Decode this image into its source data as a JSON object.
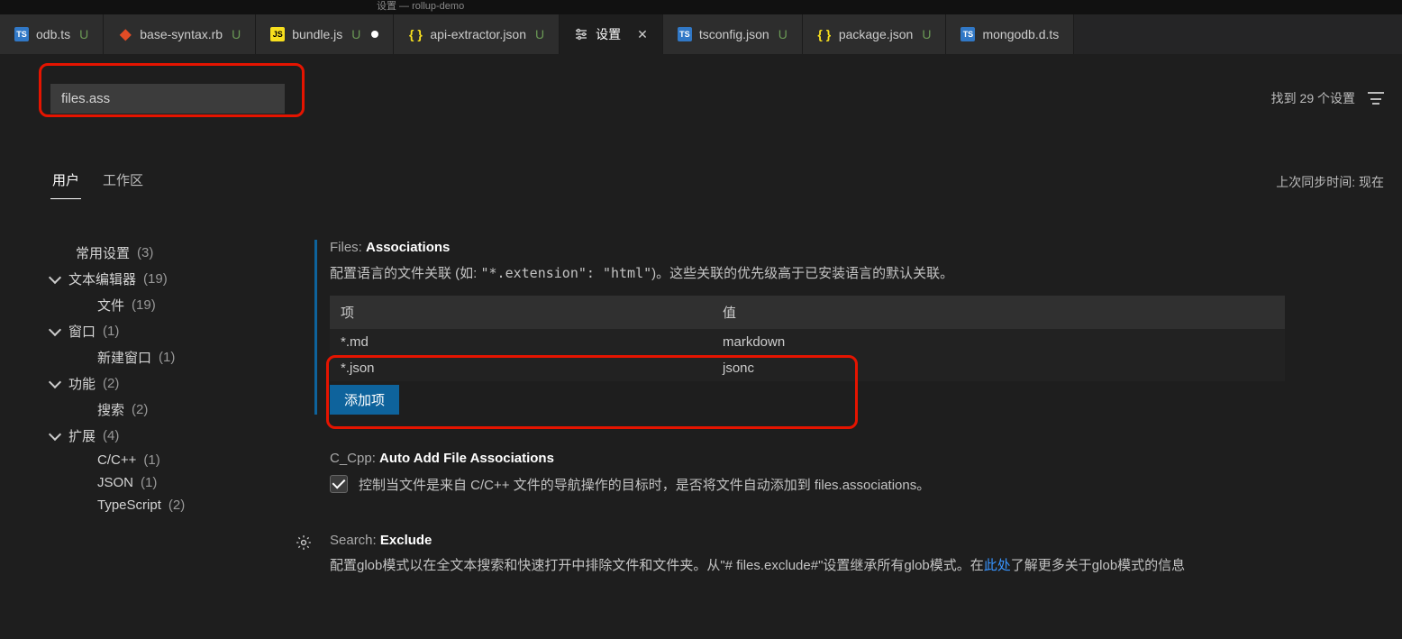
{
  "window": {
    "title": "设置 — rollup-demo"
  },
  "tabs": [
    {
      "label": "odb.ts",
      "icon": "ts",
      "git": "U",
      "active": false,
      "dirty": false,
      "close": false
    },
    {
      "label": "base-syntax.rb",
      "icon": "rb",
      "git": "U",
      "active": false,
      "dirty": false,
      "close": false
    },
    {
      "label": "bundle.js",
      "icon": "js",
      "git": "U",
      "active": false,
      "dirty": true,
      "close": false
    },
    {
      "label": "api-extractor.json",
      "icon": "json",
      "git": "U",
      "active": false,
      "dirty": false,
      "close": false
    },
    {
      "label": "设置",
      "icon": "settings",
      "git": "",
      "active": true,
      "dirty": false,
      "close": true
    },
    {
      "label": "tsconfig.json",
      "icon": "ts",
      "git": "U",
      "active": false,
      "dirty": false,
      "close": false
    },
    {
      "label": "package.json",
      "icon": "json",
      "git": "U",
      "active": false,
      "dirty": false,
      "close": false
    },
    {
      "label": "mongodb.d.ts",
      "icon": "ts",
      "git": "",
      "active": false,
      "dirty": false,
      "close": false
    }
  ],
  "search": {
    "value": "files.ass",
    "result_text": "找到 29 个设置"
  },
  "scope": {
    "tabs": {
      "user": "用户",
      "workspace": "工作区"
    },
    "sync": "上次同步时间: 现在"
  },
  "sidebar": {
    "common": {
      "label": "常用设置",
      "count": "(3)"
    },
    "editor": {
      "label": "文本编辑器",
      "count": "(19)"
    },
    "file": {
      "label": "文件",
      "count": "(19)"
    },
    "window": {
      "label": "窗口",
      "count": "(1)"
    },
    "newwin": {
      "label": "新建窗口",
      "count": "(1)"
    },
    "features": {
      "label": "功能",
      "count": "(2)"
    },
    "searchItem": {
      "label": "搜索",
      "count": "(2)"
    },
    "ext": {
      "label": "扩展",
      "count": "(4)"
    },
    "cpp": {
      "label": "C/C++",
      "count": "(1)"
    },
    "json": {
      "label": "JSON",
      "count": "(1)"
    },
    "ts": {
      "label": "TypeScript",
      "count": "(2)"
    }
  },
  "settings": {
    "assoc": {
      "title_prefix": "Files: ",
      "title_name": "Associations",
      "desc_a": "配置语言的文件关联 (如: ",
      "desc_code": "\"*.extension\": \"html\"",
      "desc_b": ")。这些关联的优先级高于已安装语言的默认关联。",
      "col_key": "项",
      "col_val": "值",
      "rows": [
        {
          "key": "*.md",
          "val": "markdown"
        },
        {
          "key": "*.json",
          "val": "jsonc"
        }
      ],
      "add_btn": "添加项"
    },
    "cpp": {
      "title_prefix": "C_Cpp: ",
      "title_name": "Auto Add File Associations",
      "desc": "控制当文件是来自 C/C++ 文件的导航操作的目标时，是否将文件自动添加到 files.associations。"
    },
    "exclude": {
      "title_prefix": "Search: ",
      "title_name": "Exclude",
      "desc_a": "配置glob模式以在全文本搜索和快速打开中排除文件和文件夹。从\"# files.exclude#\"设置继承所有glob模式。在",
      "link": "此处",
      "desc_b": "了解更多关于glob模式的信息"
    }
  }
}
